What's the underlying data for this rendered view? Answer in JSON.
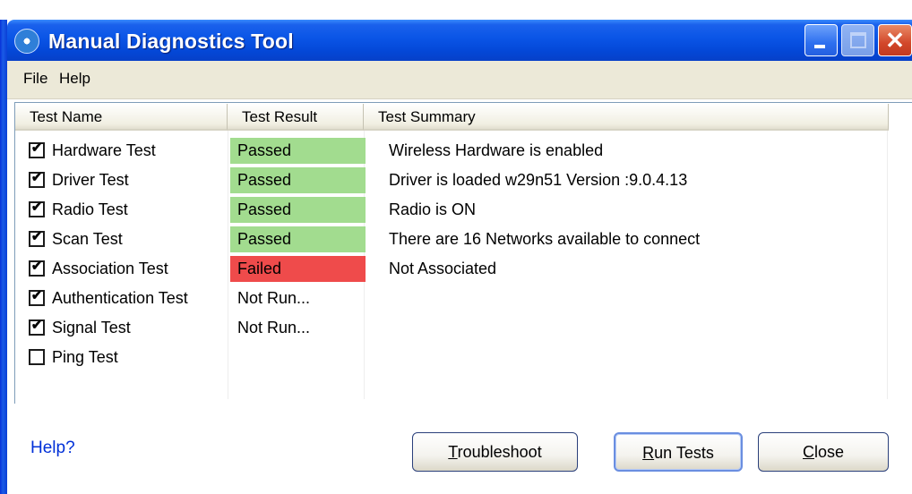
{
  "window": {
    "title": "Manual Diagnostics Tool",
    "app_icon": "wireless-signal-icon",
    "controls": {
      "minimize_icon": "minimize-icon",
      "maximize_icon": "maximize-icon",
      "close_icon": "close-icon",
      "close_glyph": "✕"
    }
  },
  "menu": {
    "items": [
      {
        "label": "File"
      },
      {
        "label": "Help"
      }
    ]
  },
  "table": {
    "columns": [
      {
        "label": "Test Name"
      },
      {
        "label": "Test Result"
      },
      {
        "label": "Test Summary"
      }
    ],
    "rows": [
      {
        "name": "Hardware Test",
        "checked": true,
        "result": "Passed",
        "status": "passed",
        "summary": "Wireless Hardware is enabled"
      },
      {
        "name": "Driver Test",
        "checked": true,
        "result": "Passed",
        "status": "passed",
        "summary": "Driver is loaded w29n51 Version :9.0.4.13"
      },
      {
        "name": "Radio Test",
        "checked": true,
        "result": "Passed",
        "status": "passed",
        "summary": "Radio is ON"
      },
      {
        "name": "Scan Test",
        "checked": true,
        "result": "Passed",
        "status": "passed",
        "summary": "There are 16 Networks available to connect"
      },
      {
        "name": "Association Test",
        "checked": true,
        "result": "Failed",
        "status": "failed",
        "summary": "Not Associated"
      },
      {
        "name": "Authentication Test",
        "checked": true,
        "result": "Not Run...",
        "status": "none",
        "summary": ""
      },
      {
        "name": "Signal Test",
        "checked": true,
        "result": "Not Run...",
        "status": "none",
        "summary": ""
      },
      {
        "name": "Ping Test",
        "checked": false,
        "result": "",
        "status": "none",
        "summary": ""
      }
    ],
    "check_glyph": "✔"
  },
  "footer": {
    "help_link": "Help?",
    "troubleshoot": {
      "mnemonic": "T",
      "rest": "roubleshoot"
    },
    "run_tests": {
      "mnemonic": "R",
      "rest": "un Tests"
    },
    "close": {
      "mnemonic": "C",
      "rest": "lose"
    }
  },
  "colors": {
    "passed": "#a2dc8f",
    "failed": "#ef4b4b",
    "titlebar": "#0a55e6",
    "link": "#0030d8"
  }
}
